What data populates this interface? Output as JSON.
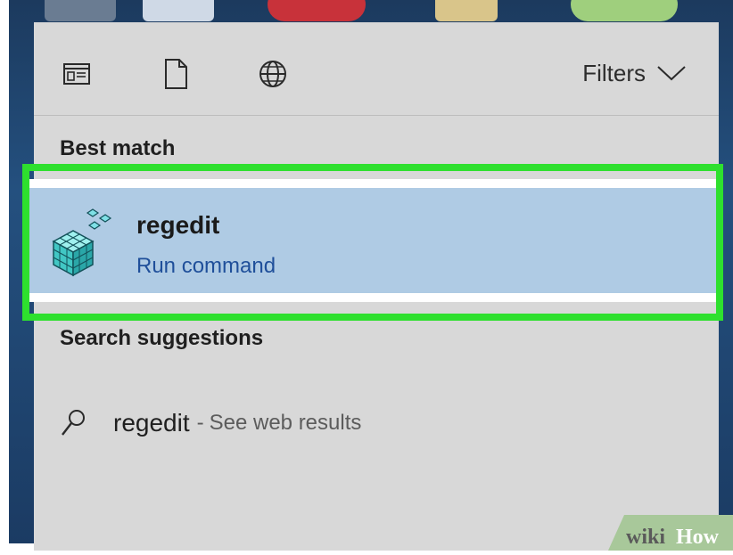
{
  "toolbar": {
    "apps_icon": "app-window-icon",
    "documents_icon": "document-icon",
    "web_icon": "globe-icon",
    "filters_label": "Filters"
  },
  "best_match": {
    "title": "Best match",
    "item": {
      "name": "regedit",
      "subtitle": "Run command",
      "icon": "registry-editor-icon"
    }
  },
  "search_suggestions": {
    "title": "Search suggestions",
    "items": [
      {
        "query": "regedit",
        "separator": "-",
        "suffix": "See web results",
        "icon": "search-icon"
      }
    ]
  },
  "watermark": {
    "text_wiki": "wiki",
    "text_how": "How"
  },
  "colors": {
    "panel_bg": "#d8d8d8",
    "highlight_bg": "#afcbe4",
    "highlight_border": "#2ee02e",
    "link_blue": "#1f4f9a"
  }
}
